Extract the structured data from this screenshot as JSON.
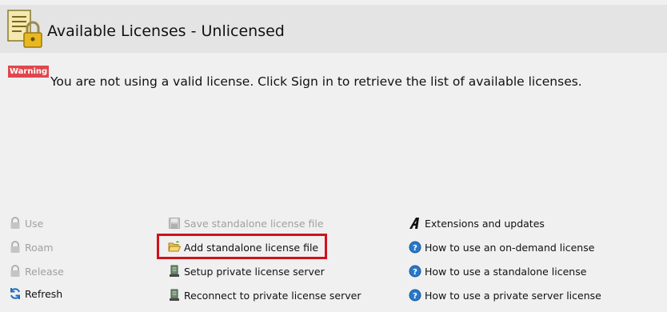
{
  "header": {
    "title": "Available Licenses - Unlicensed",
    "icon": "license-lock-icon"
  },
  "warning": {
    "badge": "Warning",
    "message": "You are not using a valid license. Click Sign in to retrieve the list of available licenses.",
    "badge_color": "#e0474c"
  },
  "actions": {
    "col1": [
      {
        "label": "Use",
        "icon": "lock-icon",
        "enabled": false
      },
      {
        "label": "Roam",
        "icon": "lock-icon",
        "enabled": false
      },
      {
        "label": "Release",
        "icon": "lock-icon",
        "enabled": false
      },
      {
        "label": "Refresh",
        "icon": "refresh-icon",
        "enabled": true
      }
    ],
    "col2": [
      {
        "label": "Save standalone license file",
        "icon": "save-icon",
        "enabled": false
      },
      {
        "label": "Add standalone license file",
        "icon": "open-folder-icon",
        "enabled": true
      },
      {
        "label": "Setup private license server",
        "icon": "server-icon",
        "enabled": true
      },
      {
        "label": "Reconnect to private license server",
        "icon": "server-icon",
        "enabled": true
      }
    ],
    "col3": [
      {
        "label": "Extensions and updates",
        "icon": "brand-a-icon",
        "enabled": true
      },
      {
        "label": "How to use an on-demand license",
        "icon": "help-icon",
        "enabled": true
      },
      {
        "label": "How to use a standalone license",
        "icon": "help-icon",
        "enabled": true
      },
      {
        "label": "How to use a private server license",
        "icon": "help-icon",
        "enabled": true
      }
    ]
  },
  "colors": {
    "highlight": "#d0121b",
    "help_blue": "#2a78c8"
  }
}
